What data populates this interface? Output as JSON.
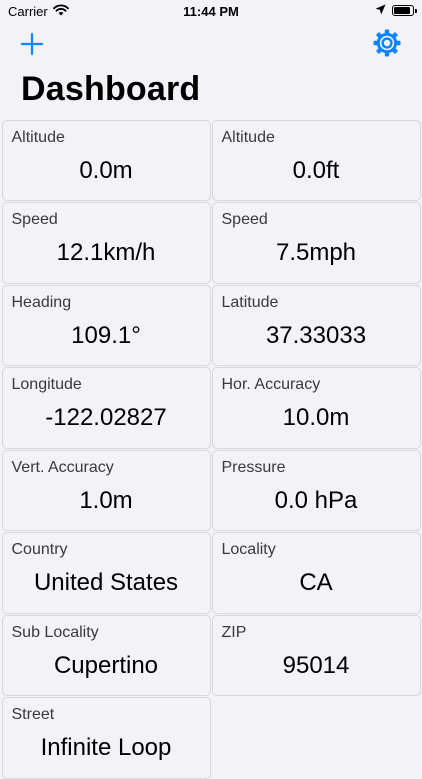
{
  "status": {
    "carrier": "Carrier",
    "time": "11:44 PM",
    "battery_level": 0.9
  },
  "nav": {
    "add_icon": "plus-icon",
    "settings_icon": "gear-icon"
  },
  "page": {
    "title": "Dashboard"
  },
  "colors": {
    "accent": "#0a84ff",
    "background": "#f2f2f7",
    "tile_border": "#d6d6db"
  },
  "tiles": [
    {
      "label": "Altitude",
      "value": "0.0m"
    },
    {
      "label": "Altitude",
      "value": "0.0ft"
    },
    {
      "label": "Speed",
      "value": "12.1km/h"
    },
    {
      "label": "Speed",
      "value": "7.5mph"
    },
    {
      "label": "Heading",
      "value": "109.1°"
    },
    {
      "label": "Latitude",
      "value": "37.33033"
    },
    {
      "label": "Longitude",
      "value": "-122.02827"
    },
    {
      "label": "Hor. Accuracy",
      "value": "10.0m"
    },
    {
      "label": "Vert. Accuracy",
      "value": "1.0m"
    },
    {
      "label": "Pressure",
      "value": "0.0 hPa"
    },
    {
      "label": "Country",
      "value": "United States"
    },
    {
      "label": "Locality",
      "value": "CA"
    },
    {
      "label": "Sub Locality",
      "value": "Cupertino"
    },
    {
      "label": "ZIP",
      "value": "95014"
    },
    {
      "label": "Street",
      "value": "Infinite Loop"
    }
  ]
}
